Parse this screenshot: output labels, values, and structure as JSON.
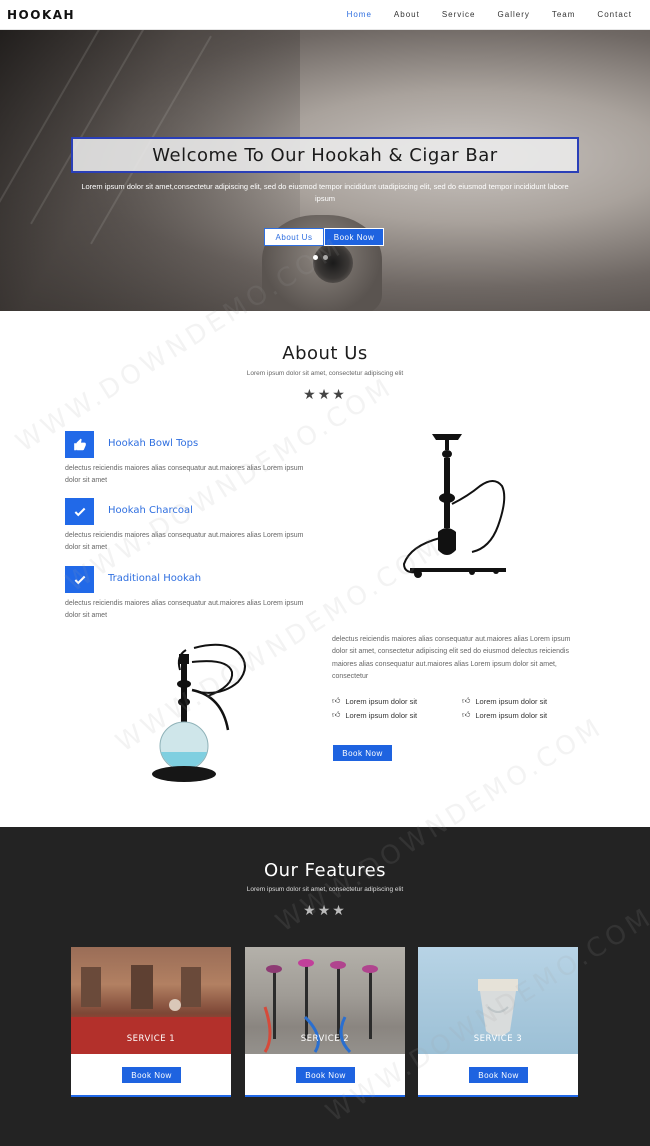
{
  "nav": {
    "brand": "HOOKAH",
    "items": [
      "Home",
      "About",
      "Service",
      "Gallery",
      "Team",
      "Contact"
    ]
  },
  "hero": {
    "title": "Welcome To Our Hookah & Cigar Bar",
    "text": "Lorem ipsum dolor sit amet,consectetur adipiscing elit, sed do eiusmod tempor incididunt utadipiscing elit, sed do eiusmod tempor incididunt labore ipsum",
    "btn_about": "About Us",
    "btn_book": "Book Now"
  },
  "about": {
    "title": "About Us",
    "subtitle": "Lorem ipsum dolor sit amet, consectetur adipiscing elit",
    "stars": "★★★",
    "features": [
      {
        "title": "Hookah Bowl Tops",
        "icon": "thumbs-up-icon",
        "desc": "delectus reiciendis maiores alias consequatur aut.maiores alias Lorem ipsum dolor sit amet"
      },
      {
        "title": "Hookah Charcoal",
        "icon": "check-icon",
        "desc": "delectus reiciendis maiores alias consequatur aut.maiores alias Lorem ipsum dolor sit amet"
      },
      {
        "title": "Traditional Hookah",
        "icon": "check-icon",
        "desc": "delectus reiciendis maiores alias consequatur aut.maiores alias Lorem ipsum dolor sit amet"
      }
    ],
    "right_text": "delectus reiciendis maiores alias consequatur aut.maiores alias Lorem ipsum dolor sit amet, consectetur adipiscing elit sed do eiusmod delectus reiciendis maiores alias consequatur aut.maiores alias Lorem ipsum dolor sit amet, consectetur",
    "checklist": [
      "Lorem ipsum dolor sit",
      "Lorem ipsum dolor sit",
      "Lorem ipsum dolor sit",
      "Lorem ipsum dolor sit"
    ],
    "book_label": "Book Now"
  },
  "features": {
    "title": "Our Features",
    "subtitle": "Lorem ipsum dolor sit amet, consectetur adipiscing elit",
    "stars": "★★★",
    "cards": [
      {
        "label": "SERVICE 1",
        "button": "Book Now"
      },
      {
        "label": "SERVICE 2",
        "button": "Book Now"
      },
      {
        "label": "SERVICE 3",
        "button": "Book Now"
      }
    ]
  },
  "watermark": "WWW.DOWNDEMO.COM",
  "colors": {
    "accent": "#2169e8",
    "dark_section": "#232323",
    "title_border": "#2a3fb8"
  }
}
